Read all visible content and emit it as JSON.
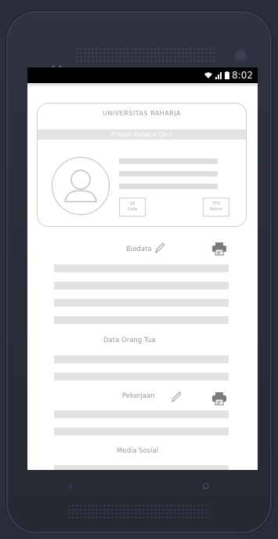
{
  "status": {
    "time": "8:02"
  },
  "card": {
    "university": "UNIVERSITAS RAHARJA",
    "subtitle": "Pribadi Raharja Card",
    "qr_label": "QR\nCode",
    "ttd_label": "TTD\nRektor"
  },
  "sections": {
    "biodata": "Biodata",
    "orang_tua": "Data Orang Tua",
    "pekerjaan": "Pekerjaan",
    "media_sosial": "Media Sosial"
  },
  "icons": {
    "edit": "pencil-icon",
    "print": "printer-icon",
    "back": "back-icon",
    "home": "home-icon"
  },
  "colors": {
    "frame": "#2b2d3b",
    "screen": "#ffffff",
    "placeholder": "#e2e2e2"
  }
}
